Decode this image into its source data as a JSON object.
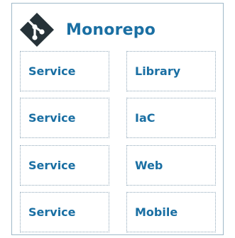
{
  "title": "Monorepo",
  "logo_icon": "git-logo-icon",
  "colors": {
    "accent": "#1a6fa3",
    "logo": "#263238",
    "border": "#9fb8c9"
  },
  "grid": {
    "left": [
      "Service",
      "Service",
      "Service",
      "Service"
    ],
    "right": [
      "Library",
      "IaC",
      "Web",
      "Mobile"
    ]
  }
}
